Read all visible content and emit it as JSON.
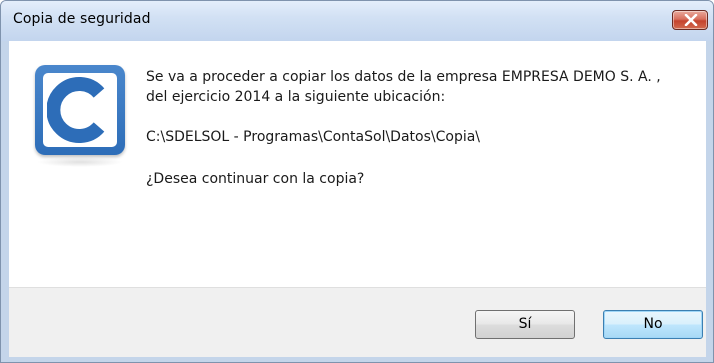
{
  "window": {
    "title": "Copia de seguridad",
    "close_icon": "close-icon"
  },
  "dialog": {
    "icon": "contasol-logo",
    "message_line1": "Se va a proceder a copiar los datos de la empresa EMPRESA DEMO S. A. ,",
    "message_line2": "del ejercicio 2014 a la siguiente ubicación:",
    "path": "C:\\SDELSOL - Programas\\ContaSol\\Datos\\Copia\\",
    "question": "¿Desea continuar con la copia?"
  },
  "buttons": {
    "yes_label": "Sí",
    "no_label": "No"
  },
  "colors": {
    "titlebar": "#c3d5ee",
    "close_button": "#c4432e",
    "logo_blue": "#2d6db8",
    "default_button_border": "#3c7fb1"
  }
}
